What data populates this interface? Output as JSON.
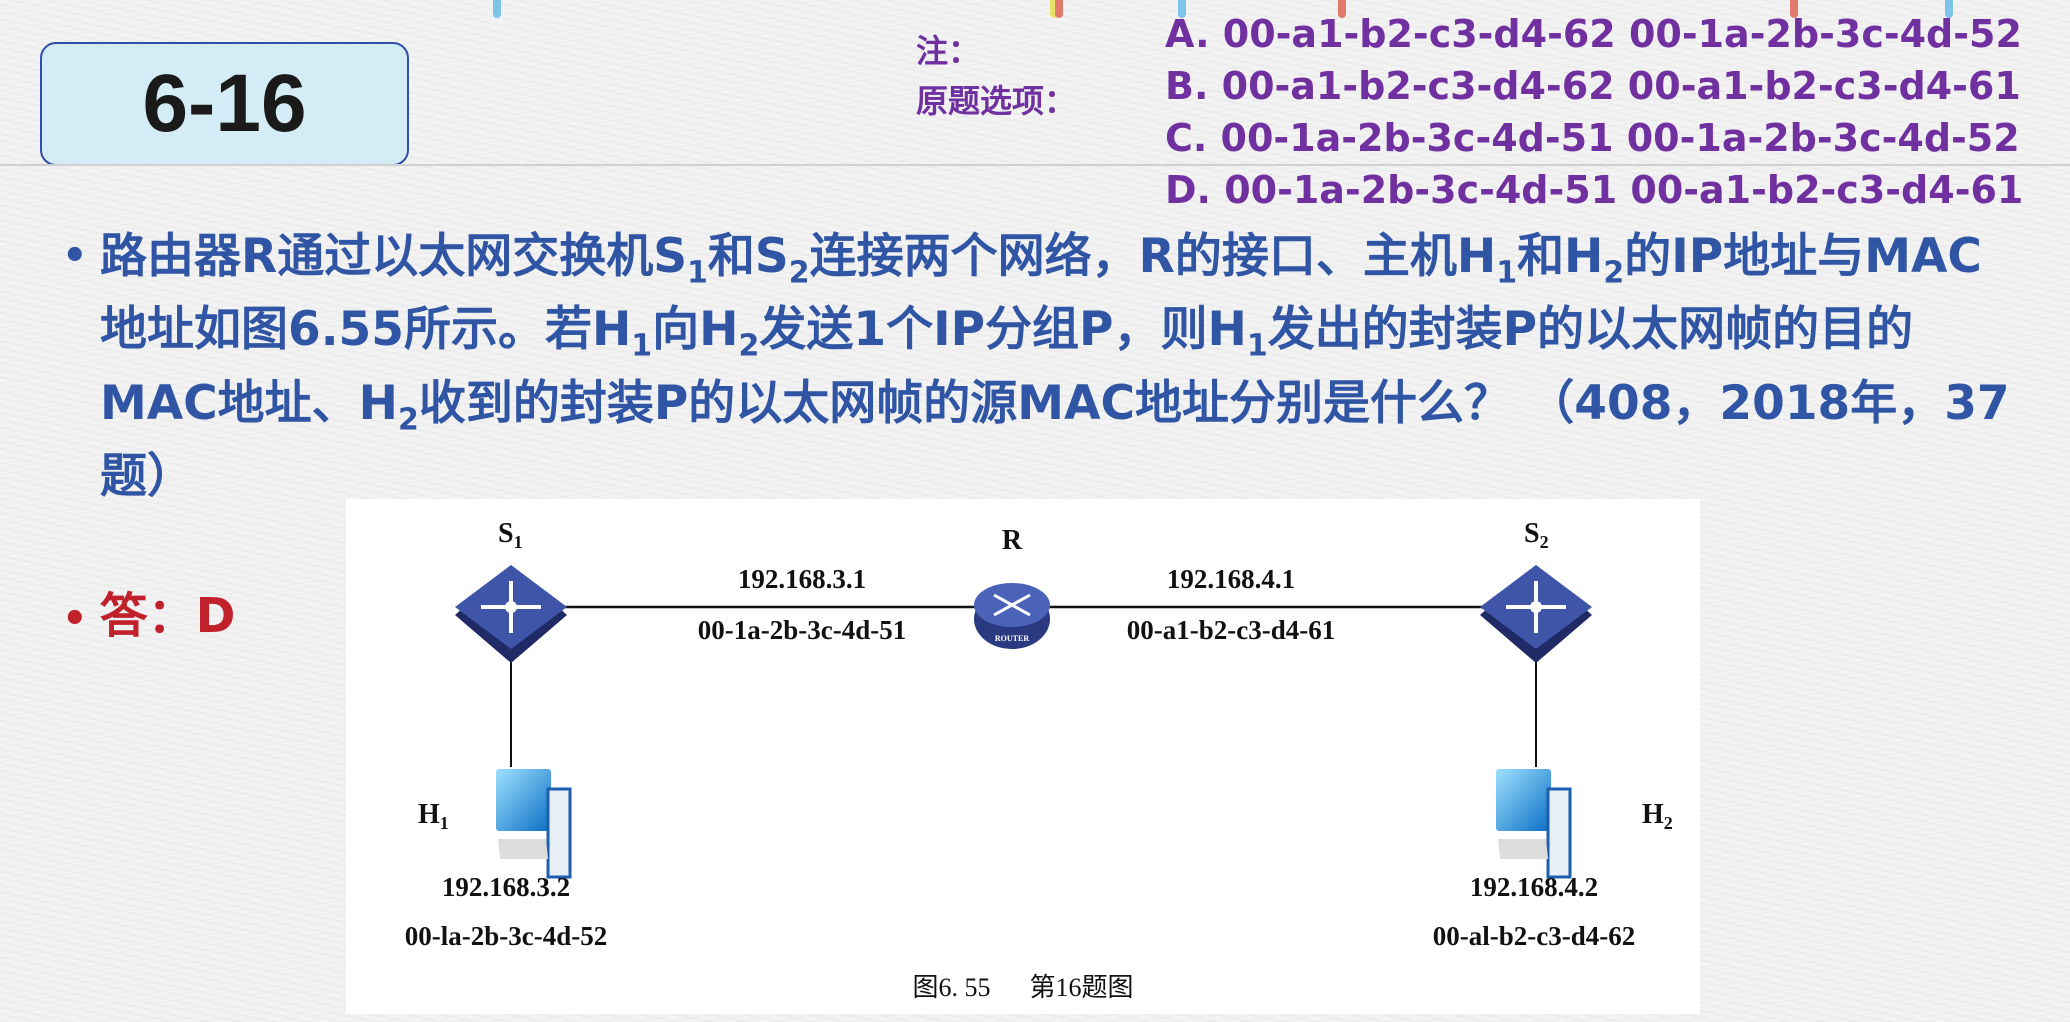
{
  "slide_number": "6-16",
  "note": {
    "label_line1": "注：",
    "label_line2": "原题选项：",
    "options": [
      "A. 00-a1-b2-c3-d4-62 00-1a-2b-3c-4d-52",
      "B. 00-a1-b2-c3-d4-62 00-a1-b2-c3-d4-61",
      "C. 00-1a-2b-3c-4d-51 00-1a-2b-3c-4d-52",
      "D. 00-1a-2b-3c-4d-51 00-a1-b2-c3-d4-61"
    ]
  },
  "question": {
    "bullet": "•",
    "parts": [
      "路由器R通过以太网交换机S",
      "1",
      "和S",
      "2",
      "连接两个网络，R的接口、主机H",
      "1",
      "和H",
      "2",
      "的IP地址与MAC地址如图6.55所示。若H",
      "1",
      "向H",
      "2",
      "发送1个IP分组P，则H",
      "1",
      "发出的封装P的以太网帧的目的MAC地址、H",
      "2",
      "收到的封装P的以太网帧的源MAC地址分别是什么？ （408，2018年，37题）"
    ]
  },
  "answer": {
    "bullet": "•",
    "text": "答：D"
  },
  "diagram": {
    "s1": "S",
    "s1_sub": "1",
    "s2": "S",
    "s2_sub": "2",
    "r": "R",
    "router_badge": "ROUTER",
    "h1": "H",
    "h1_sub": "1",
    "h2": "H",
    "h2_sub": "2",
    "r_left_ip": "192.168.3.1",
    "r_left_mac": "00-1a-2b-3c-4d-51",
    "r_right_ip": "192.168.4.1",
    "r_right_mac": "00-a1-b2-c3-d4-61",
    "h1_ip": "192.168.3.2",
    "h1_mac": "00-la-2b-3c-4d-52",
    "h2_ip": "192.168.4.2",
    "h2_mac": "00-al-b2-c3-d4-62",
    "caption": "图6. 55      第16题图"
  },
  "colors": {
    "title_bg": "#d3ecf5",
    "note": "#7030a0",
    "question": "#2f55a4",
    "answer": "#c0212b",
    "device": "#2e3f8c"
  }
}
